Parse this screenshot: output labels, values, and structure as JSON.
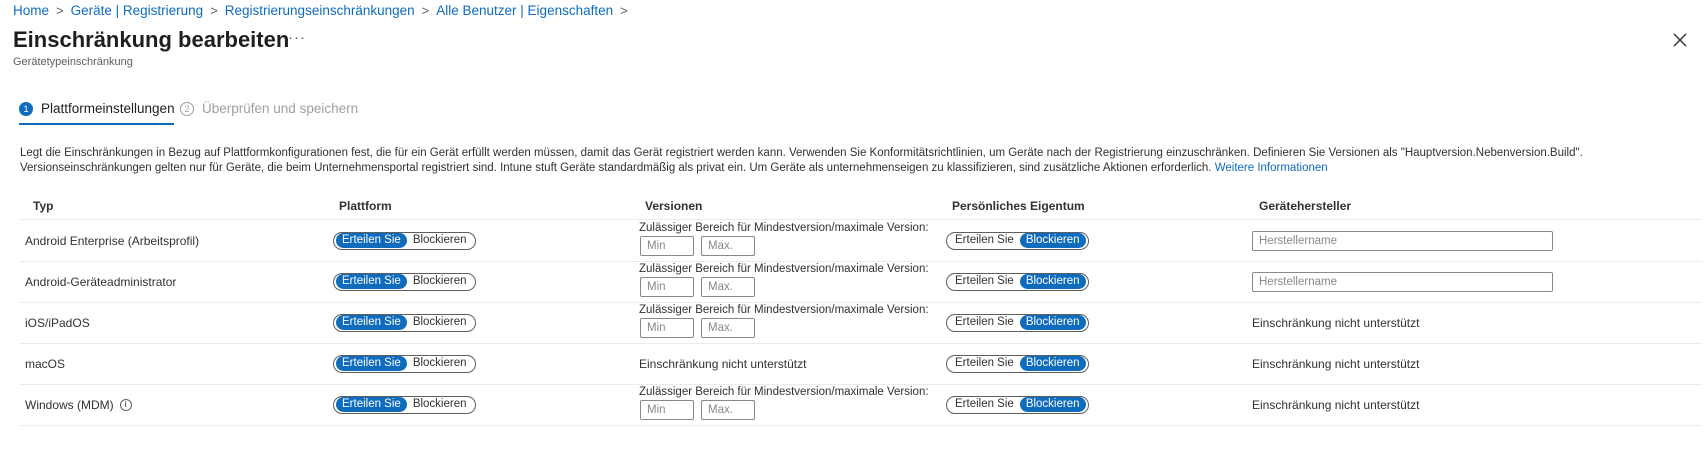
{
  "breadcrumb": [
    "Home",
    "Geräte | Registrierung",
    "Registrierungseinschränkungen",
    "Alle Benutzer | Eigenschaften"
  ],
  "title": "Einschränkung bearbeiten",
  "subtitle": "Gerätetypeinschränkung",
  "more_label": "···",
  "steps": [
    {
      "num": "1",
      "label": "Plattformeinstellungen"
    },
    {
      "num": "2",
      "label": "Überprüfen und speichern"
    }
  ],
  "description": {
    "text": "Legt die Einschränkungen in Bezug auf Plattformkonfigurationen fest, die für ein Gerät erfüllt werden müssen, damit das Gerät registriert werden kann. Verwenden Sie Konformitätsrichtlinien, um Geräte nach der Registrierung einzuschränken. Definieren Sie Versionen als \"Hauptversion.Nebenversion.Build\". Versionseinschränkungen gelten nur für Geräte, die beim Unternehmensportal registriert sind. Intune stuft Geräte standardmäßig als privat ein. Um Geräte als unternehmenseigen zu klassifizieren, sind zusätzliche Aktionen erforderlich.",
    "link": "Weitere Informationen"
  },
  "table": {
    "headers": [
      "Typ",
      "Plattform",
      "Versionen",
      "Persönliches Eigentum",
      "Gerätehersteller"
    ],
    "toggle_allow": "Erteilen Sie",
    "toggle_block": "Blockieren",
    "version_label": "Zulässiger Bereich für Mindestversion/maximale Version:",
    "min_placeholder": "Min",
    "max_placeholder": "Max.",
    "not_supported": "Einschränkung nicht unterstützt",
    "mfr_placeholder": "Herstellername",
    "rows": [
      {
        "type": "Android Enterprise (Arbeitsprofil)",
        "platform": "Erteilen Sie",
        "ownership": "Blockieren"
      },
      {
        "type": "Android-Geräteadministrator",
        "platform": "Erteilen Sie",
        "ownership": "Blockieren"
      },
      {
        "type": "iOS/iPadOS",
        "platform": "Erteilen Sie",
        "ownership": "Blockieren"
      },
      {
        "type": "macOS",
        "platform": "Erteilen Sie",
        "ownership": "Blockieren"
      },
      {
        "type": "Windows (MDM)",
        "platform": "Erteilen Sie",
        "ownership": "Blockieren"
      }
    ]
  }
}
